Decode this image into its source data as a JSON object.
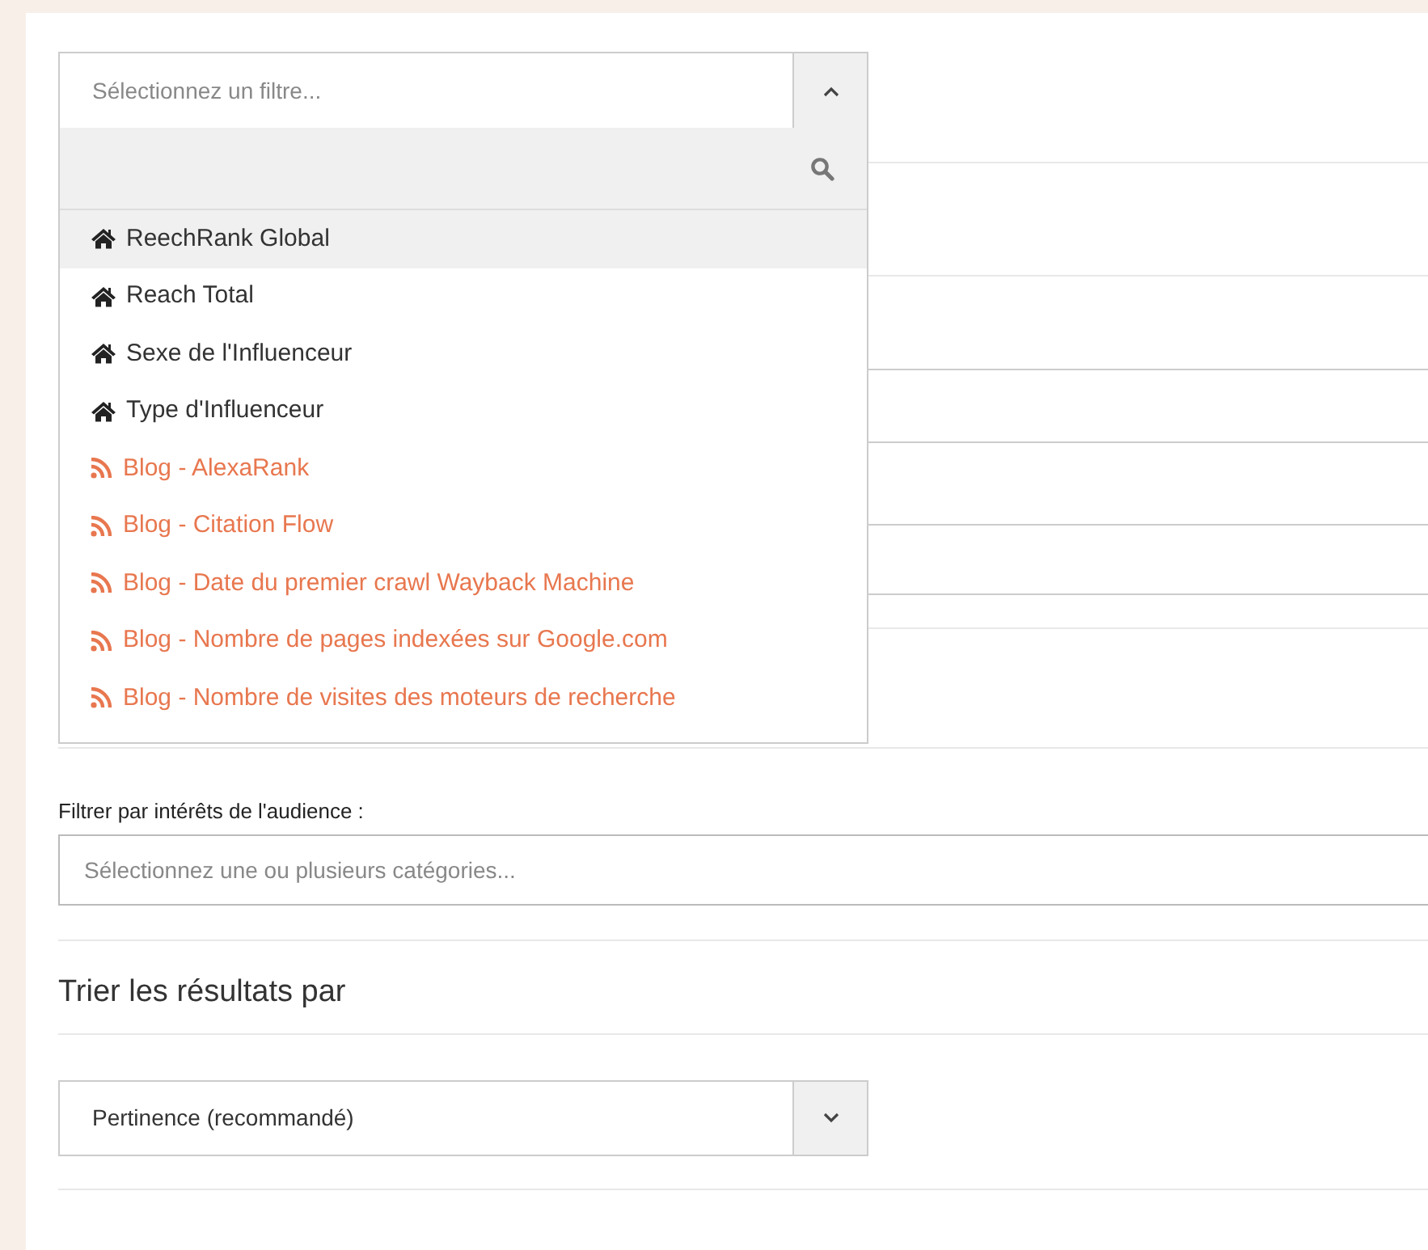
{
  "filter_select": {
    "placeholder": "Sélectionnez un filtre...",
    "expanded": true,
    "items": [
      {
        "label": "ReechRank Global",
        "kind": "home",
        "selected": true
      },
      {
        "label": "Reach Total",
        "kind": "home",
        "selected": false
      },
      {
        "label": "Sexe de l'Influenceur",
        "kind": "home",
        "selected": false
      },
      {
        "label": "Type d'Influenceur",
        "kind": "home",
        "selected": false
      },
      {
        "label": "Blog - AlexaRank",
        "kind": "rss",
        "selected": false
      },
      {
        "label": "Blog - Citation Flow",
        "kind": "rss",
        "selected": false
      },
      {
        "label": "Blog - Date du premier crawl Wayback Machine",
        "kind": "rss",
        "selected": false
      },
      {
        "label": "Blog - Nombre de pages indexées sur Google.com",
        "kind": "rss",
        "selected": false
      },
      {
        "label": "Blog - Nombre de visites des moteurs de recherche",
        "kind": "rss",
        "selected": false
      }
    ]
  },
  "audience_filter": {
    "label": "Filtrer par intérêts de l'audience :",
    "placeholder": "Sélectionnez une ou plusieurs catégories..."
  },
  "sort": {
    "heading": "Trier les résultats par",
    "value": "Pertinence (recommandé)",
    "expanded": false
  }
}
